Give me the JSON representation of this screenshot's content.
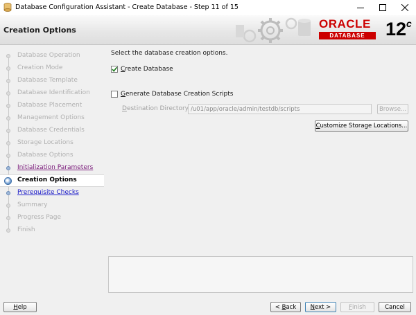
{
  "window": {
    "title": "Database Configuration Assistant - Create Database - Step 11 of 15"
  },
  "header": {
    "page_title": "Creation Options",
    "brand": {
      "oracle": "ORACLE",
      "database": "DATABASE",
      "version": "12",
      "version_suffix": "c"
    }
  },
  "sidebar": {
    "steps": [
      {
        "label": "Database Operation",
        "state": "disabled"
      },
      {
        "label": "Creation Mode",
        "state": "disabled"
      },
      {
        "label": "Database Template",
        "state": "disabled"
      },
      {
        "label": "Database Identification",
        "state": "disabled"
      },
      {
        "label": "Database Placement",
        "state": "disabled"
      },
      {
        "label": "Management Options",
        "state": "disabled"
      },
      {
        "label": "Database Credentials",
        "state": "disabled"
      },
      {
        "label": "Storage Locations",
        "state": "disabled"
      },
      {
        "label": "Database Options",
        "state": "disabled"
      },
      {
        "label": "Initialization Parameters",
        "state": "visited"
      },
      {
        "label": "Creation Options",
        "state": "current"
      },
      {
        "label": "Prerequisite Checks",
        "state": "link"
      },
      {
        "label": "Summary",
        "state": "disabled"
      },
      {
        "label": "Progress Page",
        "state": "disabled"
      },
      {
        "label": "Finish",
        "state": "disabled"
      }
    ]
  },
  "content": {
    "intro": "Select the database creation options.",
    "create_database": {
      "label": "Create Database",
      "mnemonic": "C",
      "rest": "reate Database",
      "checked": true
    },
    "generate_scripts": {
      "label": "Generate Database Creation Scripts",
      "mnemonic": "G",
      "rest": "enerate Database Creation Scripts",
      "checked": false
    },
    "destination": {
      "label": "Destination Directory:",
      "mnemonic": "D",
      "rest": "estination Directory:",
      "value": "/u01/app/oracle/admin/testdb/scripts"
    },
    "browse_label": "Browse...",
    "customize_label": "Customize Storage Locations...",
    "customize": {
      "mnemonic": "C",
      "rest": "ustomize Storage Locations..."
    }
  },
  "footer": {
    "help": {
      "label": "Help",
      "mnemonic": "H",
      "rest": "elp"
    },
    "back": {
      "label": "< Back",
      "pre": "< ",
      "mnemonic": "B",
      "rest": "ack"
    },
    "next": {
      "label": "Next >",
      "mnemonic": "N",
      "rest": "ext >"
    },
    "finish": {
      "label": "Finish",
      "mnemonic": "F",
      "rest": "inish"
    },
    "cancel": {
      "label": "Cancel"
    }
  },
  "colors": {
    "oracle_red": "#cc0000",
    "link": "#1a1ac8",
    "visited_link": "#7a1a7a",
    "disabled_text": "#b0b0b0"
  },
  "icons": [
    "app-icon",
    "minimize-icon",
    "maximize-icon",
    "close-icon",
    "gears-graphic",
    "checkmark-icon",
    "step-dot-icon"
  ]
}
